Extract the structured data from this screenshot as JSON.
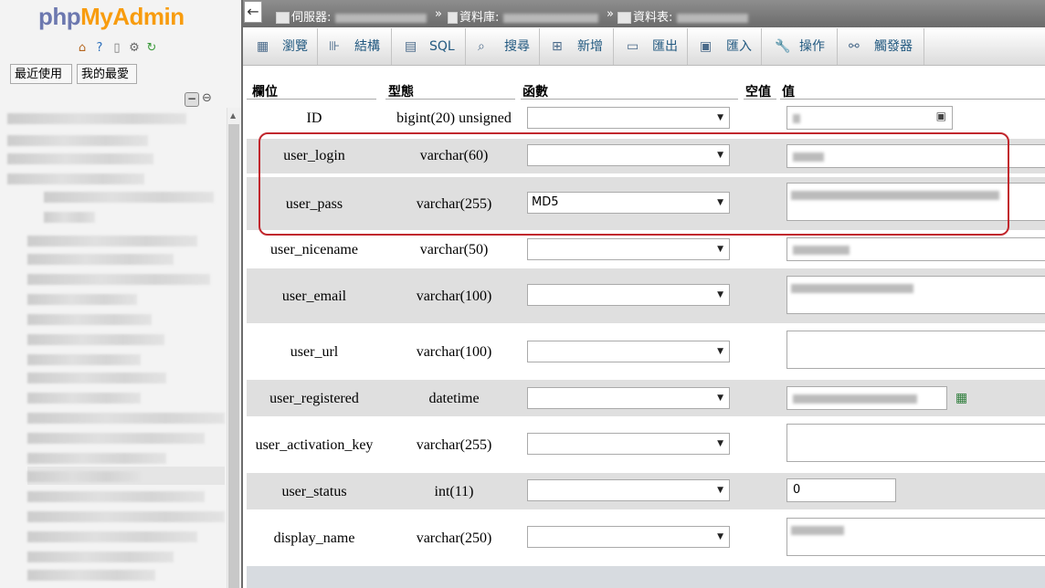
{
  "app": {
    "logo_part1": "php",
    "logo_part2": "MyAdmin"
  },
  "sidebar": {
    "icons": [
      "home-icon",
      "help-icon",
      "docs-icon",
      "settings-icon",
      "reload-icon"
    ],
    "recent_label": "最近使用",
    "favorites_label": "我的最愛"
  },
  "breadcrumb": {
    "server_label": "伺服器:",
    "database_label": "資料庫:",
    "table_label": "資料表:"
  },
  "tabs": [
    {
      "label": "瀏覽",
      "icon": "browse-icon"
    },
    {
      "label": "結構",
      "icon": "structure-icon"
    },
    {
      "label": "SQL",
      "icon": "sql-icon"
    },
    {
      "label": "搜尋",
      "icon": "search-icon"
    },
    {
      "label": "新增",
      "icon": "insert-icon"
    },
    {
      "label": "匯出",
      "icon": "export-icon"
    },
    {
      "label": "匯入",
      "icon": "import-icon"
    },
    {
      "label": "操作",
      "icon": "wrench-icon"
    },
    {
      "label": "觸發器",
      "icon": "triggers-icon"
    }
  ],
  "table": {
    "headers": {
      "column": "欄位",
      "type": "型態",
      "function": "函數",
      "null": "空值",
      "value": "值"
    },
    "rows": [
      {
        "name": "ID",
        "type": "bigint(20) unsigned",
        "function": "",
        "value": ""
      },
      {
        "name": "user_login",
        "type": "varchar(60)",
        "function": "",
        "value": ""
      },
      {
        "name": "user_pass",
        "type": "varchar(255)",
        "function": "MD5",
        "value": ""
      },
      {
        "name": "user_nicename",
        "type": "varchar(50)",
        "function": "",
        "value": ""
      },
      {
        "name": "user_email",
        "type": "varchar(100)",
        "function": "",
        "value": ""
      },
      {
        "name": "user_url",
        "type": "varchar(100)",
        "function": "",
        "value": ""
      },
      {
        "name": "user_registered",
        "type": "datetime",
        "function": "",
        "value": ""
      },
      {
        "name": "user_activation_key",
        "type": "varchar(255)",
        "function": "",
        "value": ""
      },
      {
        "name": "user_status",
        "type": "int(11)",
        "function": "",
        "value": "0"
      },
      {
        "name": "display_name",
        "type": "varchar(250)",
        "function": "",
        "value": ""
      }
    ]
  },
  "colors": {
    "highlight": "#c1272d",
    "tab_text": "#235a81",
    "logo_php": "#6c78af",
    "logo_myadmin": "#f89c0e"
  }
}
